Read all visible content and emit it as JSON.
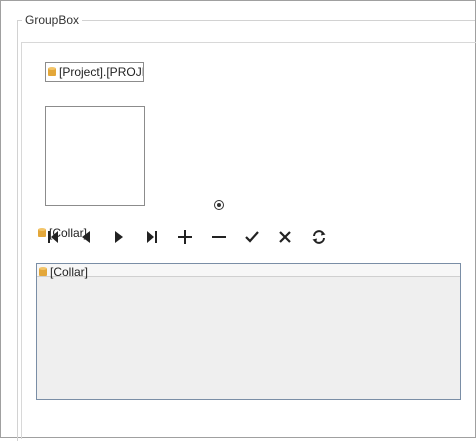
{
  "groupbox": {
    "title": "GroupBox"
  },
  "project_field": {
    "value": "[Project].[PROJE",
    "icon": "database-icon"
  },
  "radio": {
    "icon": "radio-dot-icon"
  },
  "navigator": {
    "label": "[Collar]",
    "icon": "database-icon",
    "buttons": [
      {
        "icon": "first-record-icon"
      },
      {
        "icon": "previous-record-icon"
      },
      {
        "icon": "next-record-icon"
      },
      {
        "icon": "last-record-icon"
      },
      {
        "icon": "add-record-icon"
      },
      {
        "icon": "delete-record-icon"
      },
      {
        "icon": "post-record-icon"
      },
      {
        "icon": "cancel-edit-icon"
      },
      {
        "icon": "refresh-icon"
      }
    ]
  },
  "grid": {
    "caption": "[Collar]",
    "icon": "database-icon"
  },
  "colors": {
    "db_icon": "#e3a73a",
    "grid_border": "#7a8ea6",
    "grid_bg": "#efefef"
  }
}
